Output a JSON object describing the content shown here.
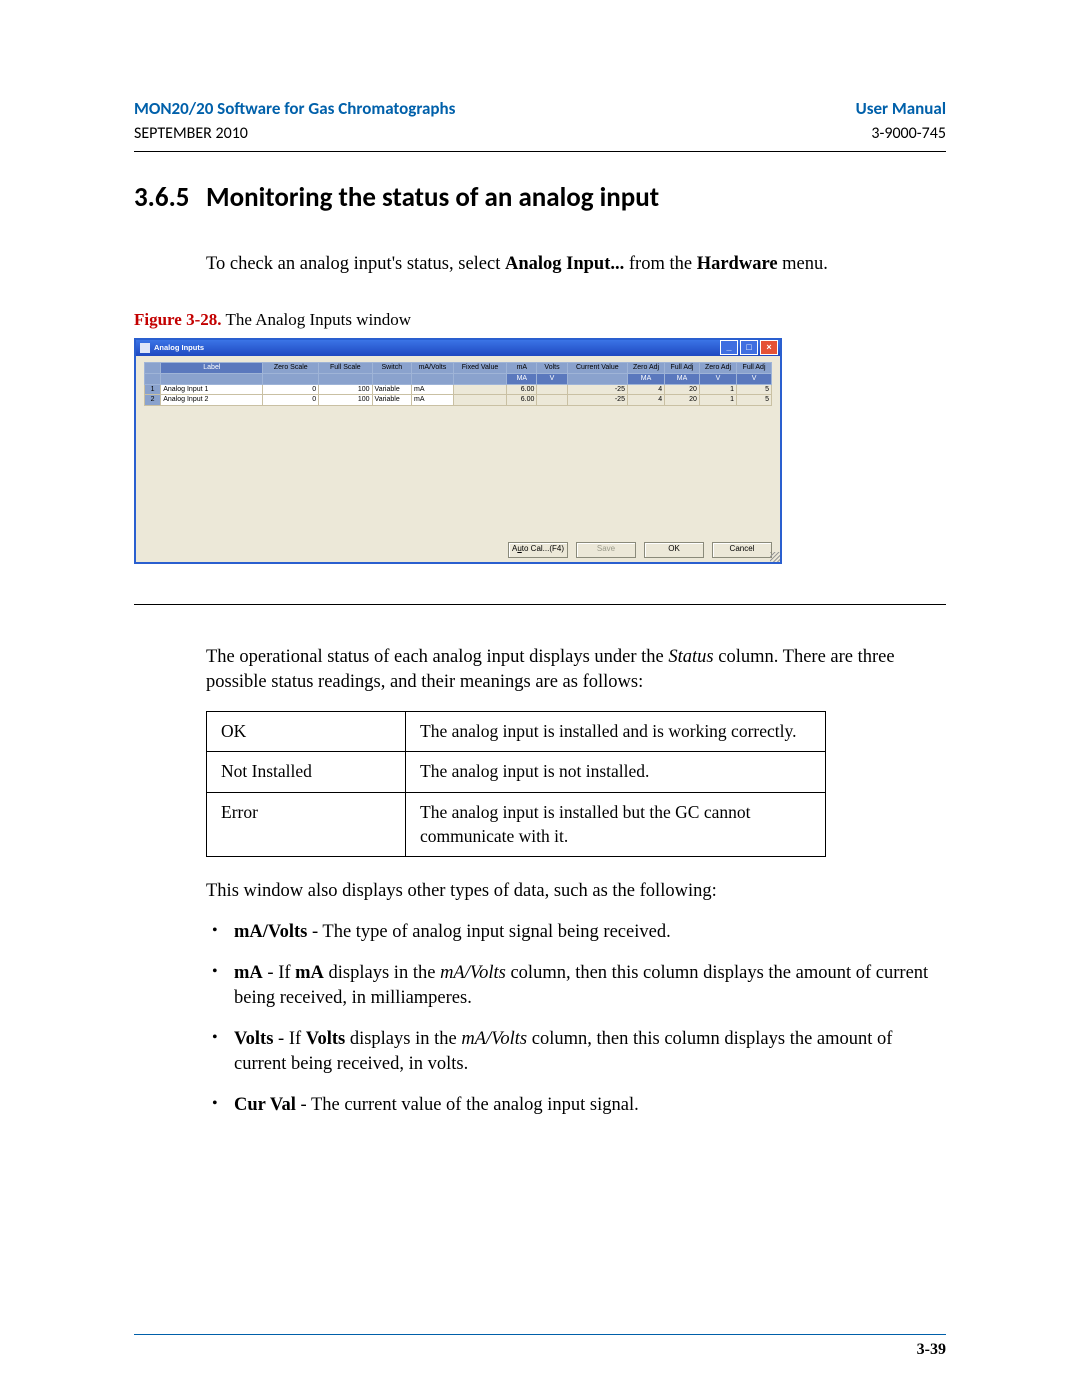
{
  "header": {
    "title_left": "MON20/20 Software for Gas Chromatographs",
    "title_right": "User Manual",
    "sub_left": "SEPTEMBER 2010",
    "sub_right": "3-9000-745"
  },
  "section": {
    "number": "3.6.5",
    "title": "Monitoring the status of an analog input"
  },
  "intro": {
    "pre": "To check an analog input's status, select ",
    "cmd": "Analog Input...",
    "mid": " from the ",
    "menu": "Hardware",
    "post": " menu."
  },
  "figure": {
    "label": "Figure 3-28.",
    "caption": "The Analog Inputs window"
  },
  "screenshot": {
    "window_title": "Analog Inputs",
    "headers_row1": [
      "",
      "Label",
      "Zero Scale",
      "Full Scale",
      "Switch",
      "mA/Volts",
      "Fixed Value",
      "mA",
      "Volts",
      "Current Value",
      "Zero Adj",
      "Full Adj",
      "Zero Adj",
      "Full Adj"
    ],
    "headers_row2": [
      "",
      "",
      "",
      "",
      "",
      "",
      "",
      "MA",
      "V",
      "",
      "MA",
      "MA",
      "V",
      "V"
    ],
    "rows": [
      {
        "n": "1",
        "label": "Analog Input 1",
        "zero": "0",
        "full": "100",
        "switch": "Variable",
        "mav": "mA",
        "fixed": "",
        "ma": "6.00",
        "v": "",
        "cur": "-25",
        "za_ma": "4",
        "fa_ma": "20",
        "za_v": "1",
        "fa_v": "5"
      },
      {
        "n": "2",
        "label": "Analog Input 2",
        "zero": "0",
        "full": "100",
        "switch": "Variable",
        "mav": "mA",
        "fixed": "",
        "ma": "6.00",
        "v": "",
        "cur": "-25",
        "za_ma": "4",
        "fa_ma": "20",
        "za_v": "1",
        "fa_v": "5"
      }
    ],
    "buttons": {
      "autocal_pre": "A",
      "autocal_u": "u",
      "autocal_post": "to Cal...(F4)",
      "save": "Save",
      "ok": "OK",
      "cancel": "Cancel"
    }
  },
  "status_para": {
    "pre": "The operational status of each analog input displays under the ",
    "col": "Status",
    "post": " column.  There are three possible status readings, and their meanings are as follows:"
  },
  "status_table": [
    {
      "k": "OK",
      "v": "The analog input is installed and is working correctly."
    },
    {
      "k": "Not Installed",
      "v": "The analog input is not installed."
    },
    {
      "k": "Error",
      "v": "The analog input is installed but the GC cannot communicate with it."
    }
  ],
  "other_para": "This window also displays other types of data, such as the following:",
  "bullets": [
    {
      "b": "mA/Volts",
      "t": " - The type of analog input signal being received."
    },
    {
      "b": "mA",
      "pre": " - If ",
      "b2": "mA",
      "mid": " displays in the ",
      "i": "mA/Volts",
      "post": " column, then this column displays the amount of current being received, in milliamperes."
    },
    {
      "b": "Volts",
      "pre": " - If ",
      "b2": "Volts",
      "mid": " displays in the ",
      "i": "mA/Volts",
      "post": " column, then this column displays the amount of current being received, in volts."
    },
    {
      "b": "Cur Val",
      "t": " - The current value of the analog input signal."
    }
  ],
  "page_number": "3-39"
}
